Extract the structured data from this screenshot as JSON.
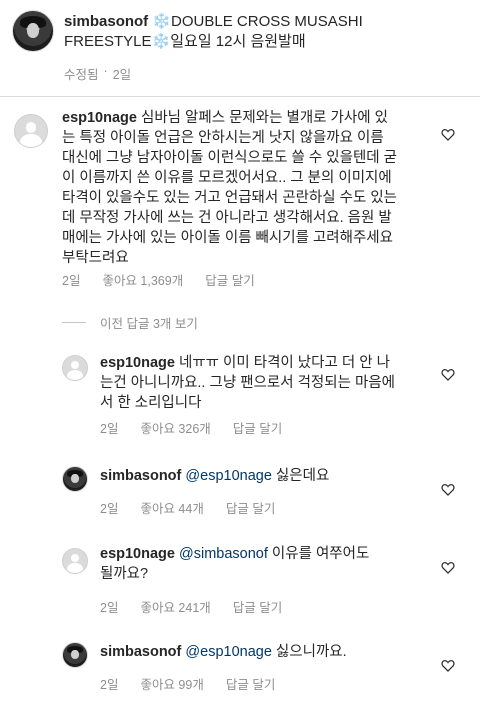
{
  "post": {
    "username": "simbasonof",
    "caption_snow1": "❄️",
    "caption_line1": "DOUBLE CROSS MUSASHI",
    "caption_line2a": "FREESTYLE",
    "caption_snow2": "❄️",
    "caption_line2b": "일요일 12시 음원발매",
    "edited": "수정됨",
    "dot": "·",
    "time": "2일"
  },
  "comment": {
    "username": "esp10nage",
    "lines": [
      "심바님 알페스 문제와는 별개로 가사에 있",
      "는 특정 아이돌 언급은 안하시는게 낫지 않을까요 이름",
      "대신에 그냥 남자아이돌 이런식으로도 쓸 수 있을텐데 굳",
      "이 이름까지 쓴 이유를 모르겠어서요.. 그 분의 이미지에",
      "타격이 있을수도 있는 거고 언급돼서 곤란하실 수도 있는",
      "데 무작정 가사에 쓰는 건 아니라고 생각해서요. 음원 발",
      "매에는 가사에 있는 아이돌 이름 빼시기를 고려해주세요",
      "부탁드려요"
    ],
    "time": "2일",
    "likes": "좋아요 1,369개",
    "reply": "답글 달기"
  },
  "view_replies": "이전 답글 3개 보기",
  "replies": [
    {
      "username": "esp10nage",
      "mention": "",
      "lines": [
        "네ㅠㅠ 이미 타격이 났다고 더 안 나",
        "는건 아니니까요.. 그냥 팬으로서 걱정되는 마음에",
        "서 한 소리입니다"
      ],
      "time": "2일",
      "likes": "좋아요 326개",
      "reply": "답글 달기"
    },
    {
      "username": "simbasonof",
      "mention": "@esp10nage",
      "lines": [
        "싫은데요"
      ],
      "time": "2일",
      "likes": "좋아요 44개",
      "reply": "답글 달기"
    },
    {
      "username": "esp10nage",
      "mention": "@simbasonof",
      "lines": [
        "이유를 여쭈어도",
        "될까요?"
      ],
      "time": "2일",
      "likes": "좋아요 241개",
      "reply": "답글 달기"
    },
    {
      "username": "simbasonof",
      "mention": "@esp10nage",
      "lines": [
        "싫으니까요."
      ],
      "time": "2일",
      "likes": "좋아요 99개",
      "reply": "답글 달기"
    }
  ]
}
